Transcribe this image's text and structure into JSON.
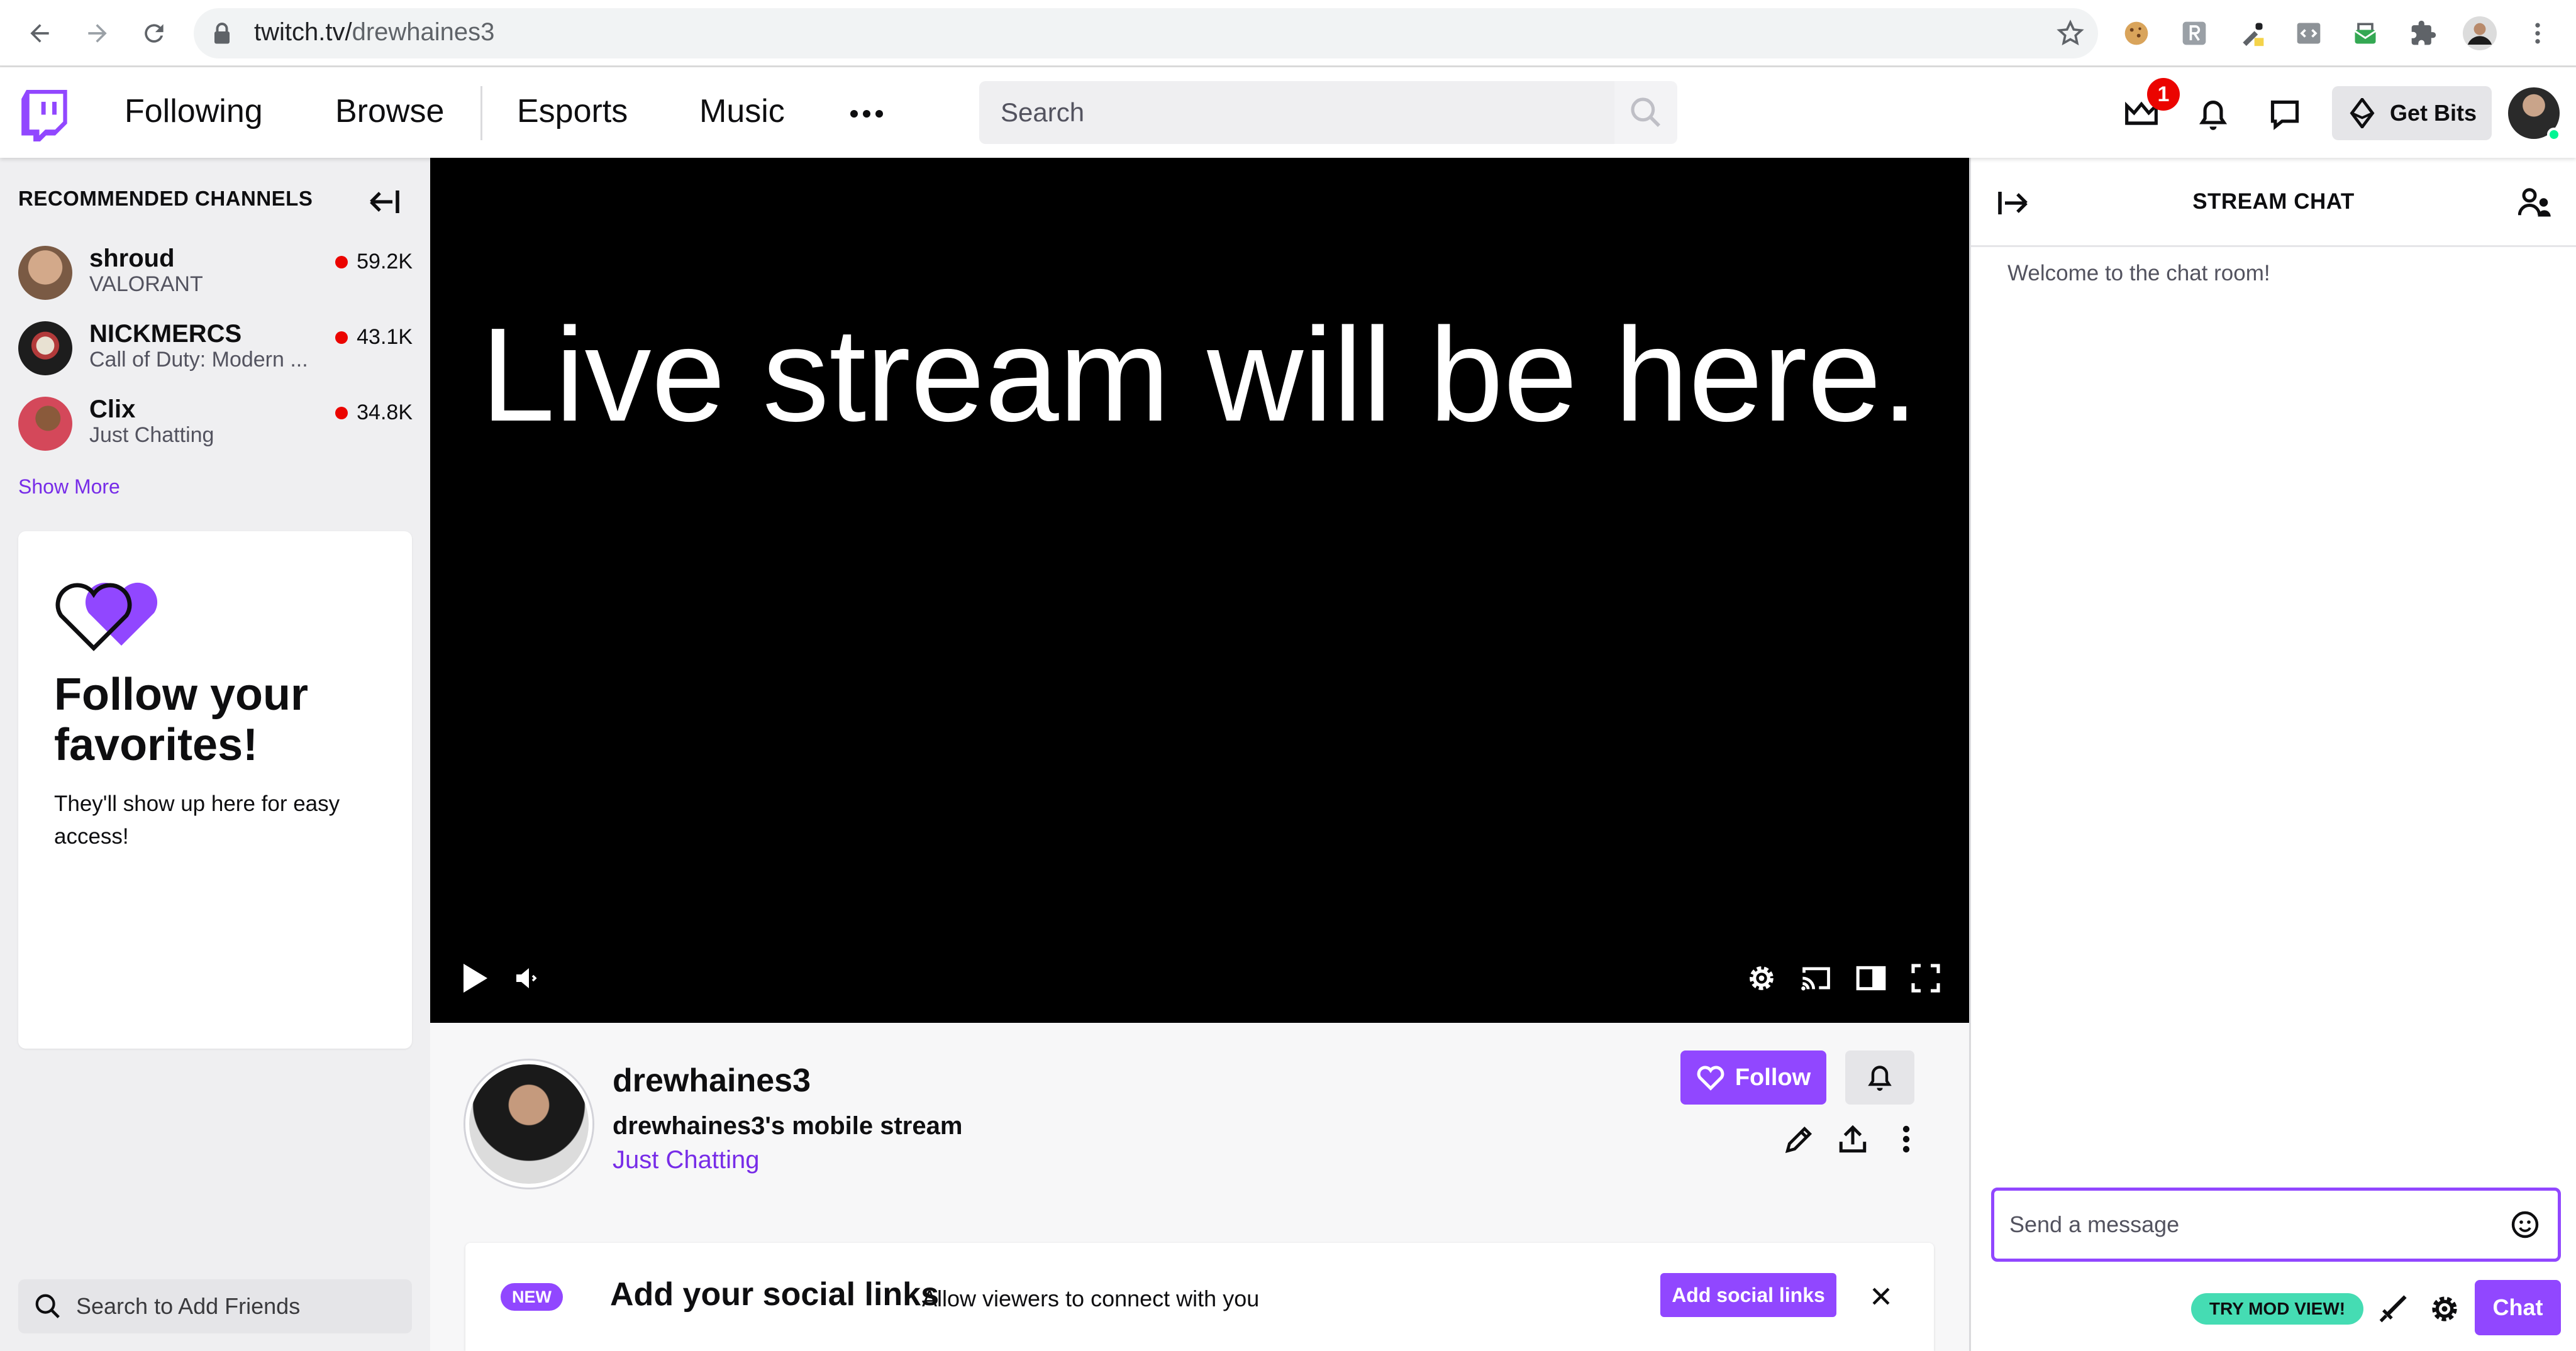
{
  "browser": {
    "url_host": "twitch.tv/",
    "url_path": "drewhaines3"
  },
  "topnav": {
    "links": [
      "Following",
      "Browse",
      "Esports",
      "Music"
    ],
    "search_placeholder": "Search",
    "notification_count": "1",
    "get_bits_label": "Get Bits"
  },
  "sidebar": {
    "title": "RECOMMENDED CHANNELS",
    "channels": [
      {
        "name": "shroud",
        "game": "VALORANT",
        "viewers": "59.2K",
        "avatar_color": "#b08a6b"
      },
      {
        "name": "NICKMERCS",
        "game": "Call of Duty: Modern ...",
        "viewers": "43.1K",
        "avatar_color": "#2b2b2b"
      },
      {
        "name": "Clix",
        "game": "Just Chatting",
        "viewers": "34.8K",
        "avatar_color": "#c2334a"
      }
    ],
    "show_more": "Show More",
    "card": {
      "title": "Follow your favorites!",
      "body": "They'll show up here for easy access!"
    },
    "friends_search_placeholder": "Search to Add Friends"
  },
  "player": {
    "placeholder_text": "Live stream will be here."
  },
  "channel": {
    "name": "drewhaines3",
    "stream_title": "drewhaines3's mobile stream",
    "game": "Just Chatting",
    "follow_label": "Follow"
  },
  "social": {
    "badge": "NEW",
    "title": "Add your social links",
    "subtitle": "Allow viewers to connect with you",
    "button": "Add social links"
  },
  "chat": {
    "title": "STREAM CHAT",
    "welcome": "Welcome to the chat room!",
    "input_placeholder": "Send a message",
    "mod_view_label": "TRY MOD VIEW!",
    "send_label": "Chat"
  },
  "colors": {
    "brand_purple": "#9147ff",
    "link_purple": "#772ce8",
    "live_red": "#eb0400",
    "mod_green": "#45dcb3"
  }
}
